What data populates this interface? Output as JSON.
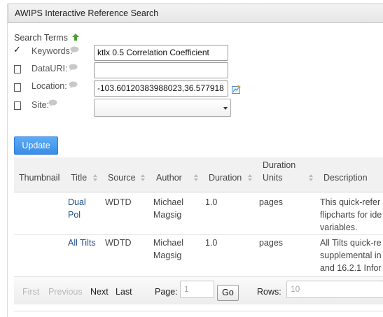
{
  "header": {
    "title": "AWIPS Interactive Reference Search"
  },
  "search": {
    "title": "Search Terms",
    "keywords": {
      "label": "Keywords:",
      "value": "ktlx 0.5 Correlation Coefficient",
      "checked": true
    },
    "datauri": {
      "label": "DataURI:",
      "value": "",
      "checked": false
    },
    "location": {
      "label": "Location:",
      "value": "-103.60120383988023,36.577918",
      "checked": false
    },
    "site": {
      "label": "Site:",
      "value": "",
      "checked": false
    }
  },
  "update_label": "Update",
  "table": {
    "columns": [
      "Thumbnail",
      "Title",
      "Source",
      "Author",
      "Duration",
      "Duration",
      "Units",
      "Description"
    ],
    "rows": [
      {
        "title1": "Dual",
        "title2": "Pol",
        "source": "WDTD",
        "author1": "Michael",
        "author2": "Magsig",
        "duration": "1.0",
        "units": "pages",
        "desc1": "This quick-refer",
        "desc2": "flipcharts for ide",
        "desc3": "variables."
      },
      {
        "title1": "All Tilts",
        "title2": "",
        "source": "WDTD",
        "author1": "Michael",
        "author2": "Magsig",
        "duration": "1.0",
        "units": "pages",
        "desc1": "All Tilts quick-re",
        "desc2": "supplemental in",
        "desc3": "and 16.2.1 Infor"
      }
    ]
  },
  "pager": {
    "first": "First",
    "previous": "Previous",
    "next": "Next",
    "last": "Last",
    "page_label": "Page:",
    "page_value": "1",
    "go": "Go",
    "rows_label": "Rows:",
    "rows_value": "10"
  },
  "colors": {
    "accent": "#3a8ee6",
    "link": "#1f4e8c",
    "up_arrow": "#4aa02c"
  },
  "icons": {
    "help": "speech-bubble-icon",
    "up": "up-arrow-icon",
    "map": "map-picker-icon",
    "sort": "sort-arrows-icon"
  }
}
